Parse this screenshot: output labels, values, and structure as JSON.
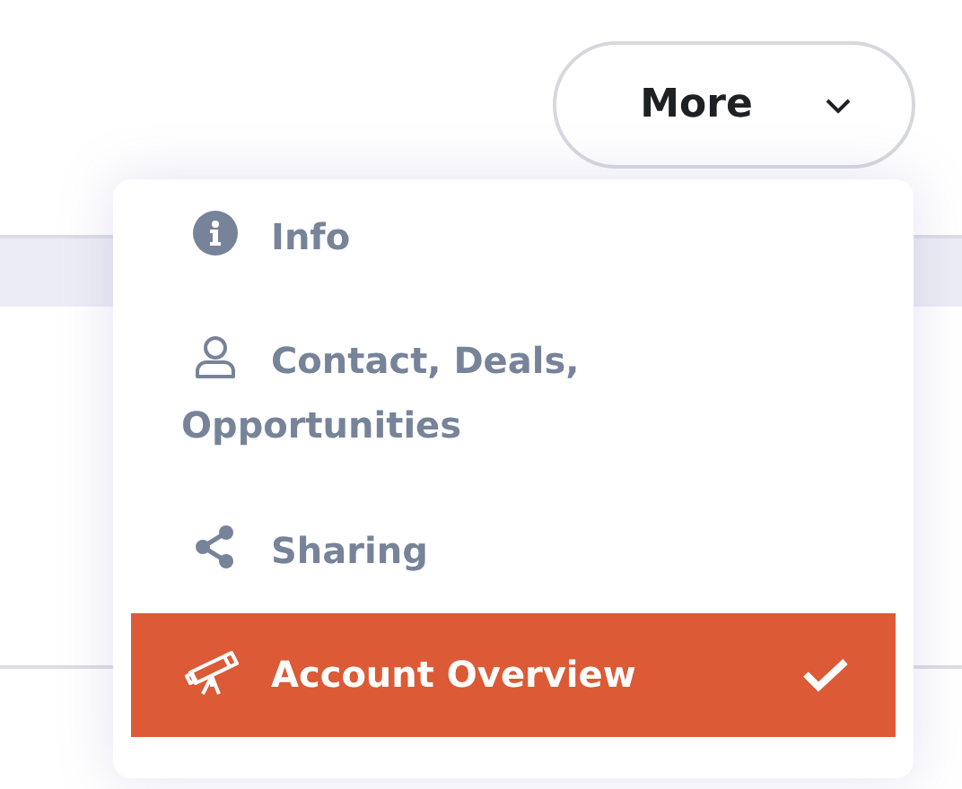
{
  "more_button": {
    "label": "More"
  },
  "menu": {
    "items": [
      {
        "label": "Info",
        "selected": false
      },
      {
        "label": "Contact, Deals, Opportunities",
        "selected": false
      },
      {
        "label": "Sharing",
        "selected": false
      },
      {
        "label": "Account Overview",
        "selected": true
      }
    ]
  }
}
